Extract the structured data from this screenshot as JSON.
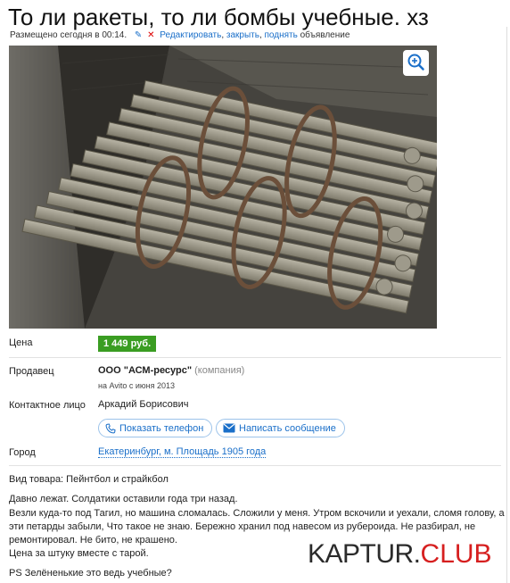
{
  "listing": {
    "title": "То ли ракеты, то ли бомбы учебные. хз",
    "posted": "Размещено сегодня в 00:14.",
    "actions": {
      "edit": "Редактировать",
      "close": "закрыть",
      "raise": "поднять",
      "suffix": "объявление"
    }
  },
  "photo": {
    "zoom_icon": "magnifier-plus-icon"
  },
  "details": {
    "price_label": "Цена",
    "price": "1 449 руб.",
    "seller_label": "Продавец",
    "seller_name": "ООО \"АСМ-ресурс\"",
    "seller_kind": "(компания)",
    "seller_since": "на Avito с июня 2013",
    "contact_label": "Контактное лицо",
    "contact_name": "Аркадий Борисович",
    "show_phone": "Показать телефон",
    "write_message": "Написать сообщение",
    "city_label": "Город",
    "city": "Екатеринбург, м. Площадь 1905 года"
  },
  "description": {
    "goods_type": "Вид товара: Пейнтбол и страйкбол",
    "lines": [
      "Давно лежат. Солдатики оставили года три назад.",
      "Везли куда-то под Тагил, но машина сломалась. Сложили у меня. Утром вскочили и уехали, сломя голову, а",
      "эти петарды забыли, Что такое не знаю. Бережно хранил под навесом из рубероида. Не разбирал, не",
      "ремонтировал. Не бито, не крашено.",
      "Цена за штуку вместе с тарой.",
      "PS Зелёненькие это ведь учебные?"
    ]
  },
  "watermark": {
    "part1": "KAPTUR.",
    "part2": "CLUB"
  },
  "colors": {
    "link": "#1a6fc9",
    "price_bg": "#3a9d22",
    "watermark_red": "#d61f1f"
  }
}
